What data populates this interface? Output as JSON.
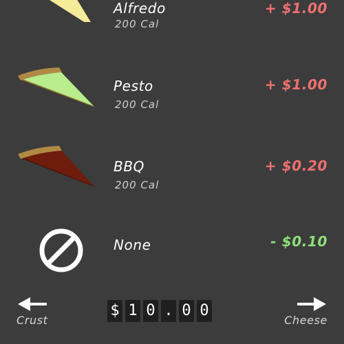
{
  "sauce_options": [
    {
      "name": "Alfredo",
      "calories": "200 Cal",
      "price": "+ $1.00",
      "sauce_color": "#f6eb9a",
      "price_color": "#f07070",
      "icon": "alfredo-pizza-slice-icon"
    },
    {
      "name": "Pesto",
      "calories": "200 Cal",
      "price": "+ $1.00",
      "sauce_color": "#b8ec8c",
      "price_color": "#f07070",
      "icon": "pesto-pizza-slice-icon"
    },
    {
      "name": "BBQ",
      "calories": "200 Cal",
      "price": "+ $0.20",
      "sauce_color": "#6e1c0c",
      "price_color": "#f07070",
      "icon": "bbq-pizza-slice-icon"
    },
    {
      "name": "None",
      "price": "- $0.10",
      "price_color": "#8ee07a",
      "icon": "no-sauce-icon"
    }
  ],
  "navigation": {
    "back_label": "Crust",
    "next_label": "Cheese"
  },
  "total": {
    "digits": [
      "$",
      "1",
      "0",
      ".",
      "0",
      "0"
    ]
  },
  "colors": {
    "background": "#3c3c3c",
    "crust": "#b08a45",
    "increase_price": "#f07070",
    "decrease_price": "#8ee07a"
  }
}
